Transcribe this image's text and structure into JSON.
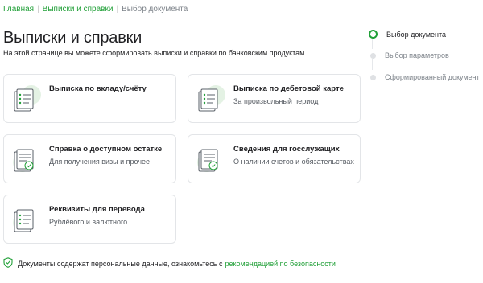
{
  "breadcrumb": {
    "home": "Главная",
    "statements": "Выписки и справки",
    "current": "Выбор документа"
  },
  "page": {
    "title": "Выписки и справки",
    "subtitle": "На этой странице вы можете сформировать выписки и справки по банковским продуктам"
  },
  "cards": [
    {
      "title": "Выписка по вкладу/счёту",
      "desc": ""
    },
    {
      "title": "Выписка по дебетовой карте",
      "desc": "За произвольный период"
    },
    {
      "title": "Справка о доступном остатке",
      "desc": "Для получения визы и прочее"
    },
    {
      "title": "Сведения для госслужащих",
      "desc": "О наличии счетов и обязательствах"
    },
    {
      "title": "Реквизиты для перевода",
      "desc": "Рублёвого и валютного"
    }
  ],
  "steps": [
    {
      "label": "Выбор документа",
      "active": true
    },
    {
      "label": "Выбор параметров",
      "active": false
    },
    {
      "label": "Сформированный документ",
      "active": false
    }
  ],
  "footer": {
    "text": "Документы содержат персональные данные, ознакомьтесь с",
    "link": "рекомендацией по безопасности"
  },
  "colors": {
    "accent": "#21a038",
    "icon_bg": "#e4f2e4"
  }
}
